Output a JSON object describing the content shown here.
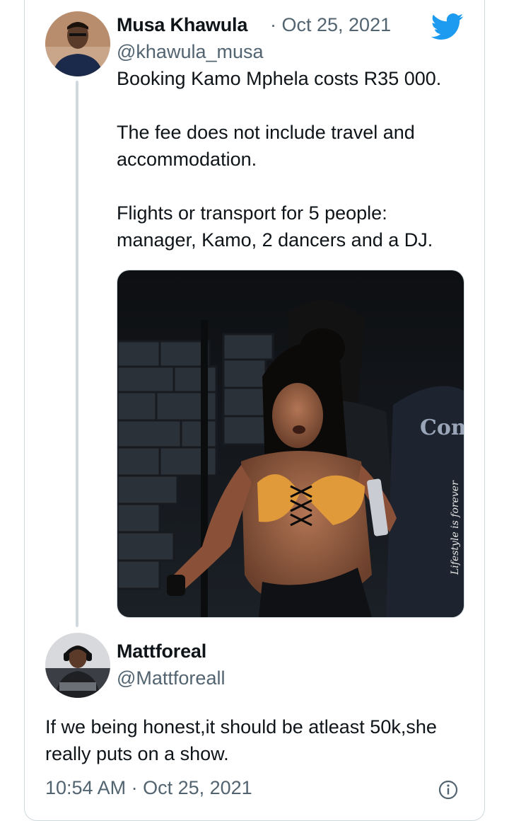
{
  "tweet1": {
    "display_name": "Musa Khawula",
    "date": "· Oct 25, 2021",
    "handle": "@khawula_musa",
    "text": "Booking Kamo Mphela costs R35 000.\n\nThe fee does not include travel and accommodation.\n\nFlights or transport for 5 people: manager, Kamo, 2 dancers and a DJ.",
    "media_watermark": "Lifestyle is forever",
    "media_jacket_text": "Com"
  },
  "tweet2": {
    "display_name": "Mattforeal",
    "handle": "@Mattforeall",
    "text": "If we being honest,it should be atleast 50k,she really puts on a show."
  },
  "footer": {
    "timestamp": "10:54 AM · Oct 25, 2021"
  },
  "icons": {
    "brand": "twitter-bird-icon",
    "info": "info-icon"
  },
  "colors": {
    "twitter_blue": "#1d9bf0",
    "secondary_text": "#536471",
    "border": "#cfd9de"
  }
}
